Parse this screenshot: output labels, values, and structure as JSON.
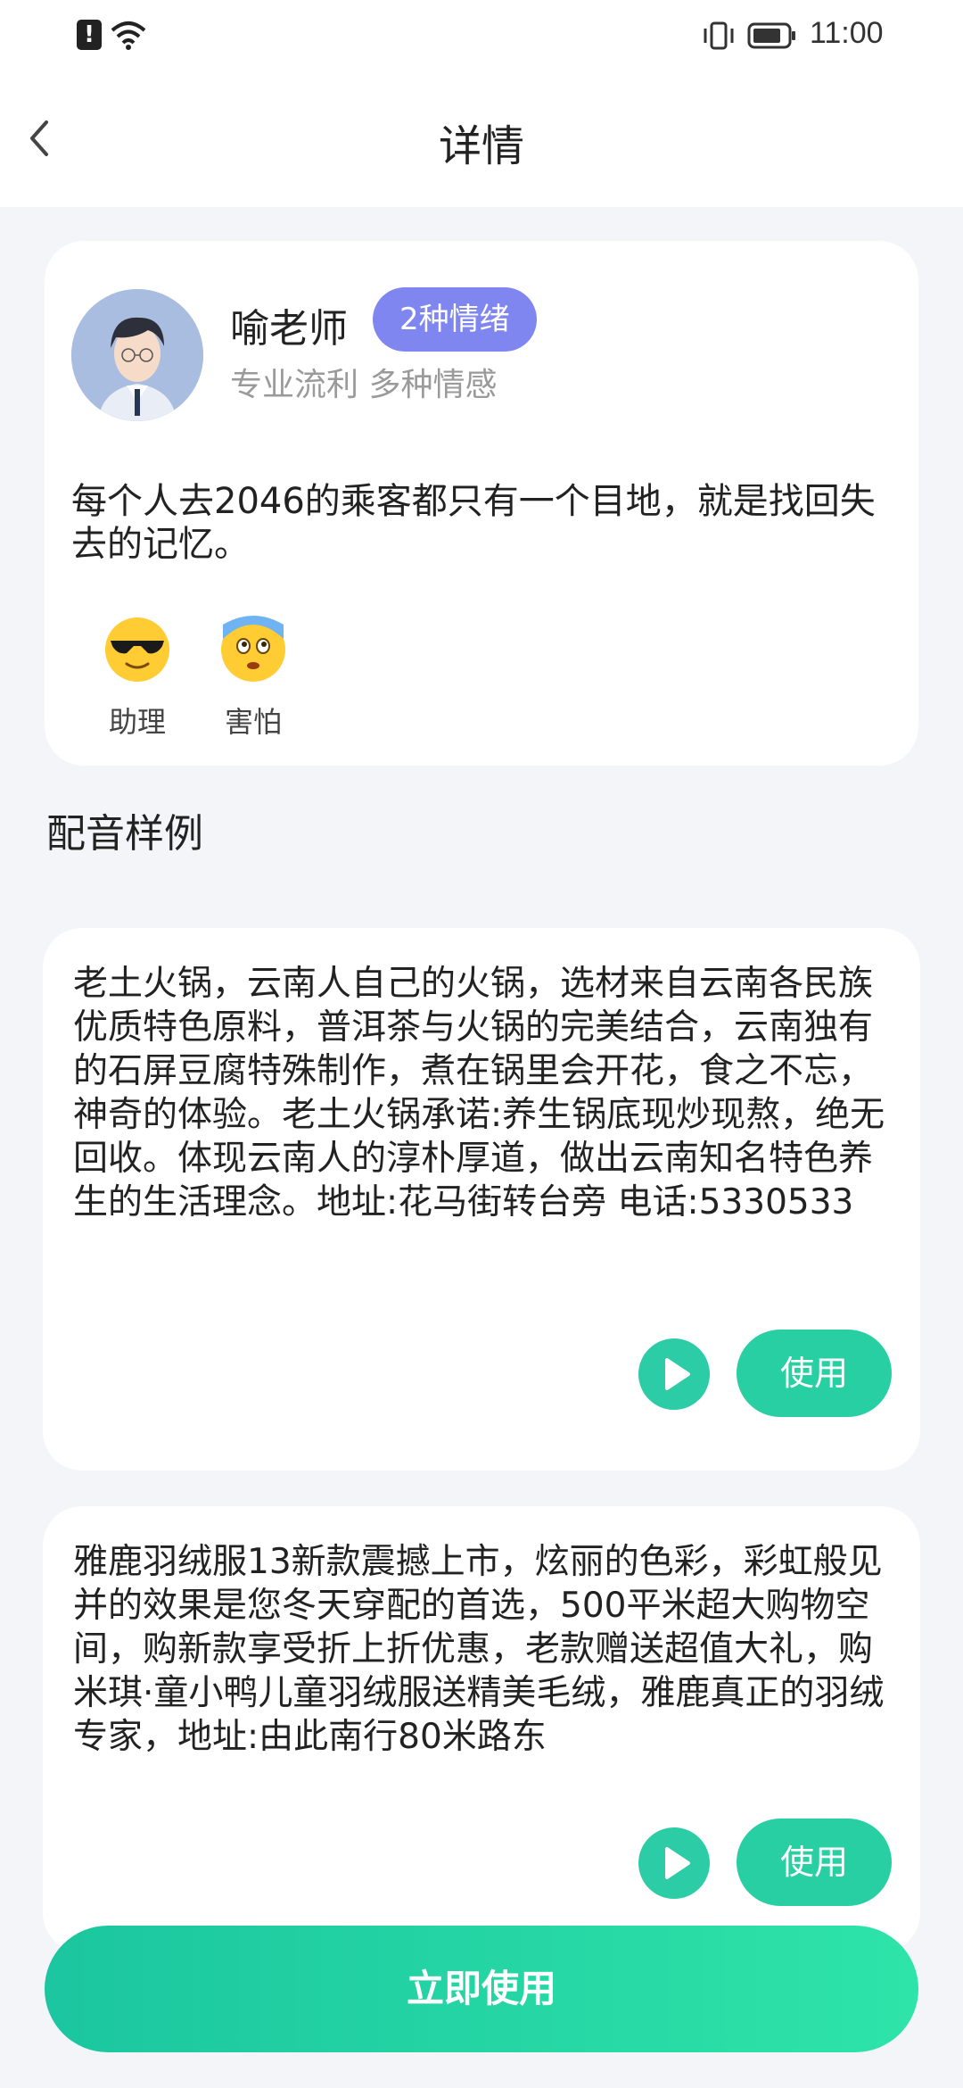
{
  "status_bar": {
    "time": "11:00"
  },
  "header": {
    "title": "详情"
  },
  "profile": {
    "name": "喻老师",
    "badge": "2种情绪",
    "subtitle": "专业流利 多种情感",
    "quote": "每个人去2046的乘客都只有一个目地，就是找回失去的记忆。",
    "emotions": [
      {
        "label": "助理",
        "icon": "sunglasses-emoji-icon"
      },
      {
        "label": "害怕",
        "icon": "fearful-emoji-icon"
      }
    ]
  },
  "section": {
    "title": "配音样例"
  },
  "samples": [
    {
      "text": "老土火锅，云南人自己的火锅，选材来自云南各民族优质特色原料，普洱茶与火锅的完美结合，云南独有的石屏豆腐特殊制作，煮在锅里会开花，食之不忘，神奇的体验。老土火锅承诺:养生锅底现炒现熬，绝无回收。体现云南人的淳朴厚道，做出云南知名特色养生的生活理念。地址:花马街转台旁 电话:5330533",
      "use_label": "使用"
    },
    {
      "text": "雅鹿羽绒服13新款震撼上市，炫丽的色彩，彩虹般见并的效果是您冬天穿配的首选，500平米超大购物空间，购新款享受折上折优惠，老款赠送超值大礼，购米琪·童小鸭儿童羽绒服送精美毛绒，雅鹿真正的羽绒专家，地址:由此南行80米路东",
      "use_label": "使用"
    }
  ],
  "cta": {
    "label": "立即使用"
  },
  "colors": {
    "accent": "#27cfa2",
    "badge": "#7f86f0",
    "background": "#f3f5f9"
  }
}
